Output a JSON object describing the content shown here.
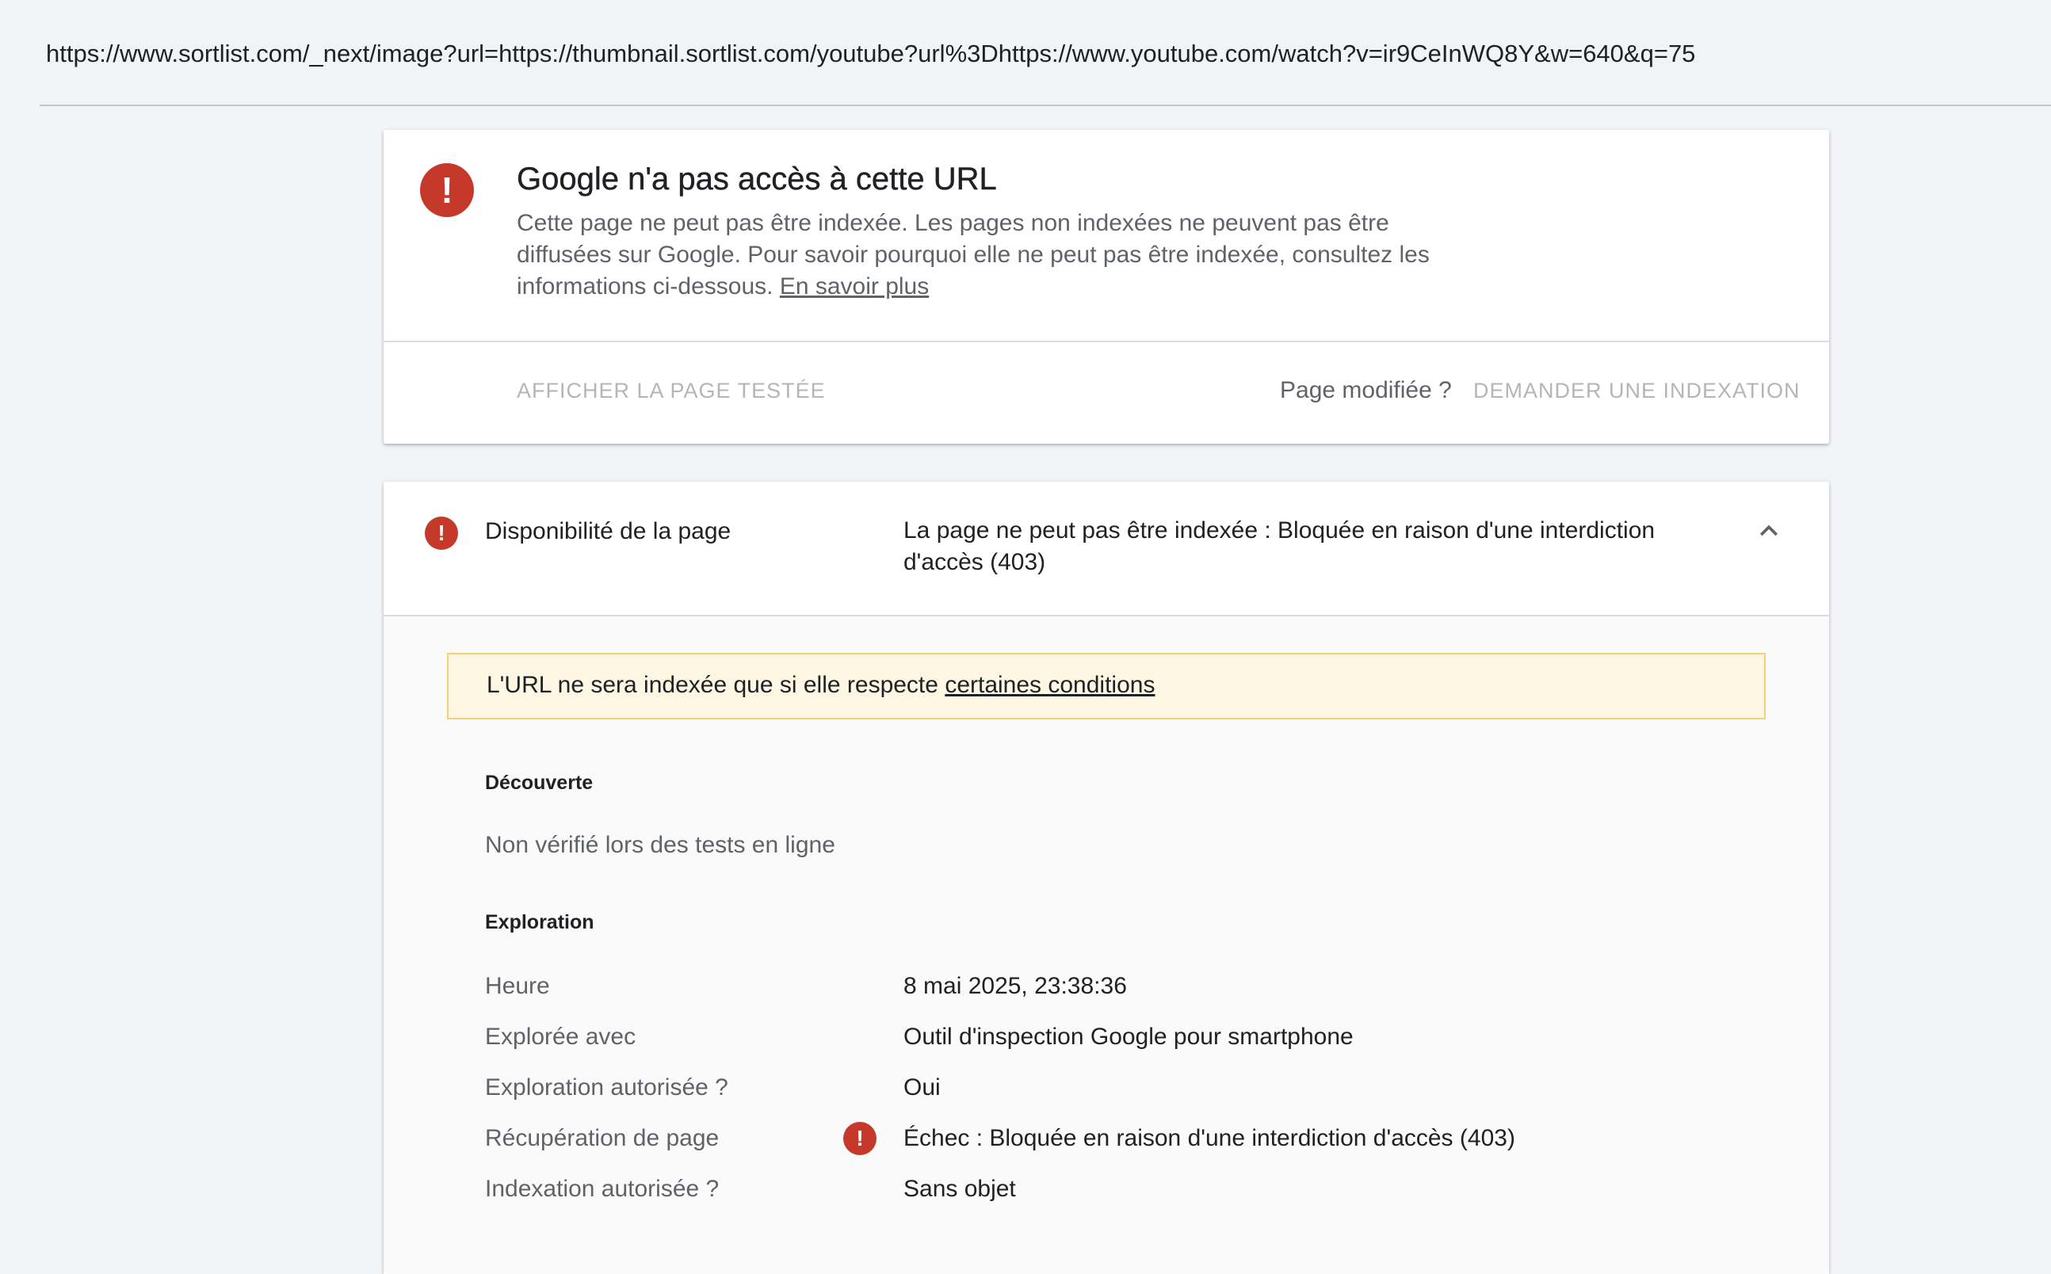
{
  "url_bar": {
    "url": "https://www.sortlist.com/_next/image?url=https://thumbnail.sortlist.com/youtube?url%3Dhttps://www.youtube.com/watch?v=ir9CeInWQ8Y&w=640&q=75"
  },
  "status_card": {
    "icon": "error-icon",
    "title": "Google n'a pas accès à cette URL",
    "description": "Cette page ne peut pas être indexée. Les pages non indexées ne peuvent pas être diffusées sur Google. Pour savoir pourquoi elle ne peut pas être indexée, consultez les informations ci-dessous.",
    "learn_more": "En savoir plus",
    "view_tested_page": "AFFICHER LA PAGE TESTÉE",
    "page_modified": "Page modifiée ?",
    "request_indexing": "DEMANDER UNE INDEXATION"
  },
  "availability": {
    "icon": "error-icon",
    "label": "Disponibilité de la page",
    "value": "La page ne peut pas être indexée : Bloquée en raison d'une interdiction d'accès (403)",
    "chevron_icon": "chevron-up-icon",
    "notice": {
      "text": "L'URL ne sera indexée que si elle respecte",
      "link": "certaines conditions"
    },
    "discovery": {
      "heading": "Découverte",
      "text": "Non vérifié lors des tests en ligne"
    },
    "crawl": {
      "heading": "Exploration",
      "rows": [
        {
          "key": "Heure",
          "value": "8 mai 2025, 23:38:36",
          "error": false
        },
        {
          "key": "Explorée avec",
          "value": "Outil d'inspection Google pour smartphone",
          "error": false
        },
        {
          "key": "Exploration autorisée ?",
          "value": "Oui",
          "error": false
        },
        {
          "key": "Récupération de page",
          "value": "Échec : Bloquée en raison d'une interdiction d'accès (403)",
          "error": true
        },
        {
          "key": "Indexation autorisée ?",
          "value": "Sans objet",
          "error": false
        }
      ]
    }
  },
  "colors": {
    "error": "#c5392b",
    "notice_bg": "#fcf6e3",
    "notice_border": "#f0d374",
    "disabled_text": "#b3b5b8"
  }
}
